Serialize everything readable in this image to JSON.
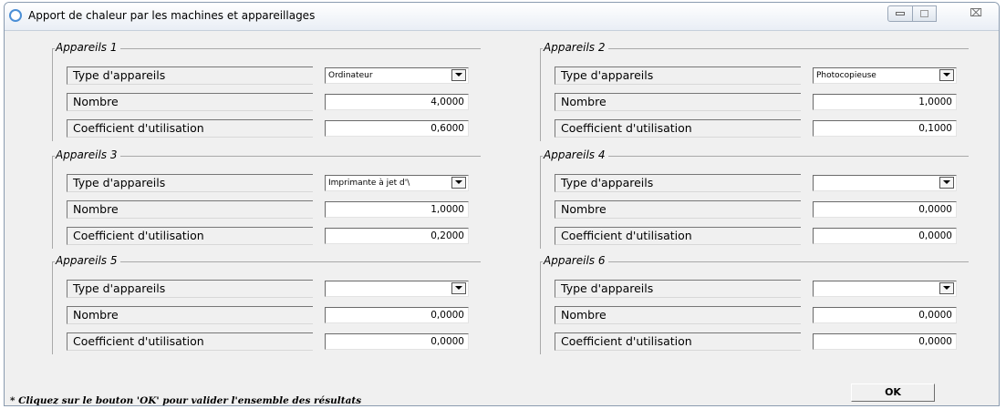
{
  "window": {
    "title": "Apport de chaleur par les machines et appareillages",
    "controls": {
      "minimize": "",
      "maximize": "",
      "close": "⌧"
    }
  },
  "labels": {
    "type": "Type d'appareils",
    "nombre": "Nombre",
    "coefficient": "Coefficient d'utilisation"
  },
  "groups": [
    {
      "title": "Appareils 1",
      "type_value": "Ordinateur",
      "nombre": "4,0000",
      "coefficient": "0,6000"
    },
    {
      "title": "Appareils 2",
      "type_value": "Photocopieuse",
      "nombre": "1,0000",
      "coefficient": "0,1000"
    },
    {
      "title": "Appareils 3",
      "type_value": "Imprimante à jet d'\\",
      "nombre": "1,0000",
      "coefficient": "0,2000"
    },
    {
      "title": "Appareils 4",
      "type_value": "",
      "nombre": "0,0000",
      "coefficient": "0,0000"
    },
    {
      "title": "Appareils 5",
      "type_value": "",
      "nombre": "0,0000",
      "coefficient": "0,0000"
    },
    {
      "title": "Appareils 6",
      "type_value": "",
      "nombre": "0,0000",
      "coefficient": "0,0000"
    }
  ],
  "footer": {
    "note": "* Cliquez sur le bouton 'OK' pour valider l'ensemble des résultats",
    "ok_label": "OK"
  }
}
